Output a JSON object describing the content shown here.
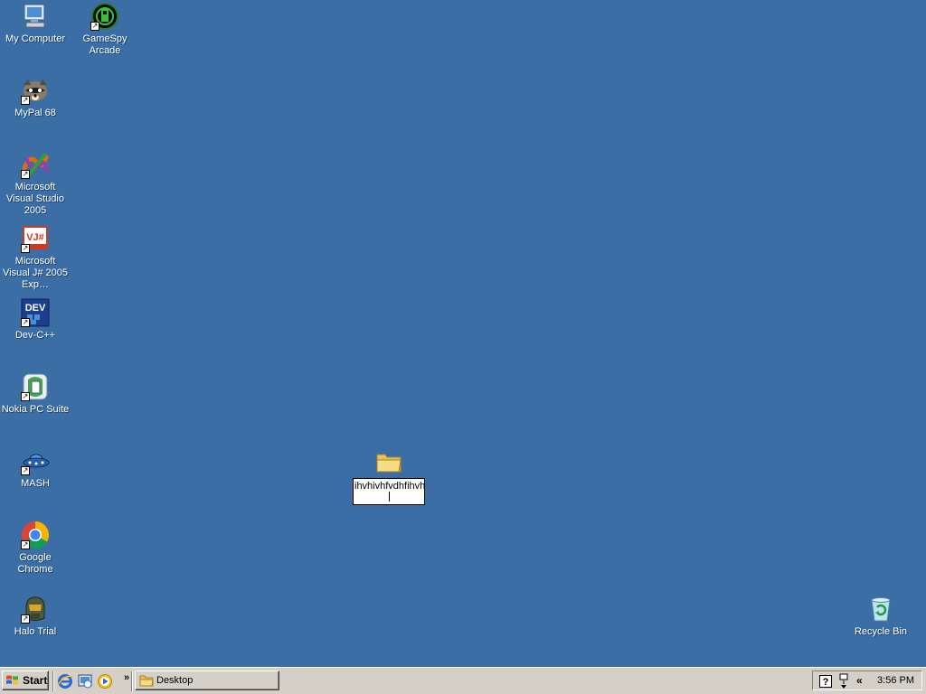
{
  "desktop": {
    "background": "#3a6ea5",
    "icons": [
      {
        "label": "My Computer",
        "icon": "computer-icon"
      },
      {
        "label": "GameSpy Arcade",
        "icon": "gamespy-icon"
      },
      {
        "label": "MyPal 68",
        "icon": "raccoon-icon"
      },
      {
        "label": "Microsoft Visual Studio 2005",
        "icon": "visual-studio-icon"
      },
      {
        "label": "Microsoft Visual J# 2005 Exp…",
        "icon": "vjsharp-icon",
        "badge": "VJ#"
      },
      {
        "label": "Dev-C++",
        "icon": "devcpp-icon",
        "badge": "DEV"
      },
      {
        "label": "Nokia PC Suite",
        "icon": "nokia-icon"
      },
      {
        "label": "MASH",
        "icon": "ufo-icon"
      },
      {
        "label": "Google Chrome",
        "icon": "chrome-icon"
      },
      {
        "label": "Halo Trial",
        "icon": "halo-icon"
      },
      {
        "label": "Recycle Bin",
        "icon": "recycle-bin-icon"
      }
    ],
    "renaming_folder": {
      "icon": "folder-icon",
      "name_value": "ihvhivhfvdhfihvhh"
    }
  },
  "taskbar": {
    "start_label": "Start",
    "quick_launch": [
      "ie-icon",
      "show-desktop-icon",
      "media-player-icon"
    ],
    "overflow_label": "»",
    "task_button_label": "Desktop",
    "tray": {
      "help_icon": "?",
      "expand_label": "«",
      "clock": "3:56 PM"
    }
  }
}
